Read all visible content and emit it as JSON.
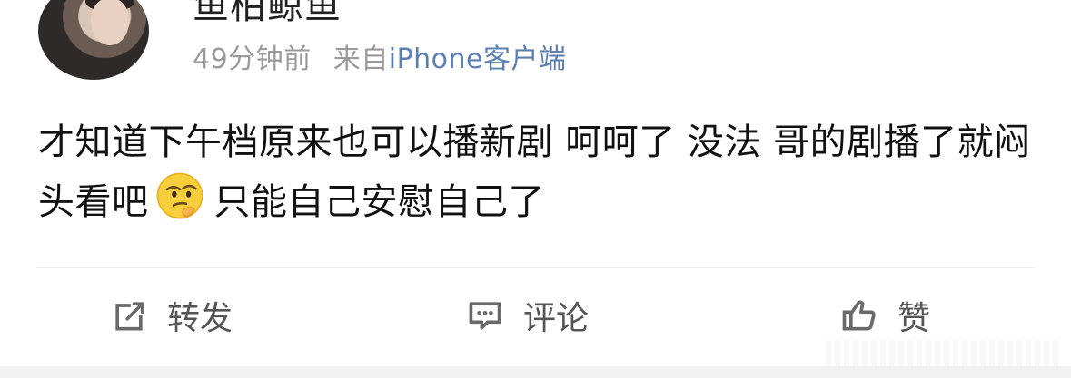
{
  "post": {
    "username": "鱼柏鲸鱼",
    "time": "49分钟前",
    "source_prefix": "来自",
    "source_client": "iPhone客户端",
    "text_before_emoji": "才知道下午档原来也可以播新剧 呵呵了 没法 哥的剧播了就闷头看吧",
    "emoji": "thinking-face",
    "text_after_emoji": "只能自己安慰自己了"
  },
  "actions": {
    "repost_label": "转发",
    "comment_label": "评论",
    "like_label": "赞"
  },
  "colors": {
    "link": "#5b7fb3",
    "meta": "#9a9a9a",
    "divider": "#ececec"
  }
}
